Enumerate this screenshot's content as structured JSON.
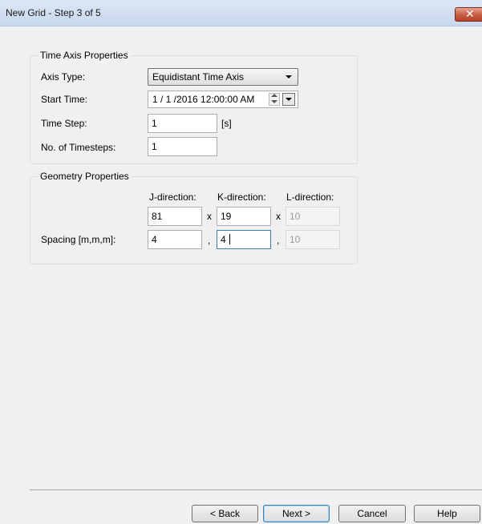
{
  "window": {
    "title": "New Grid - Step 3 of 5",
    "close_glyph": "✕"
  },
  "time_axis": {
    "legend": "Time Axis Properties",
    "axis_type_label": "Axis Type:",
    "axis_type_value": "Equidistant Time Axis",
    "start_time_label": "Start Time:",
    "start_time_value": "1 / 1 /2016 12:00:00 AM",
    "time_step_label": "Time Step:",
    "time_step_value": "1",
    "time_step_unit": "[s]",
    "timesteps_label": "No. of Timesteps:",
    "timesteps_value": "1"
  },
  "geometry": {
    "legend": "Geometry Properties",
    "j_header": "J-direction:",
    "k_header": "K-direction:",
    "l_header": "L-direction:",
    "j_count": "81",
    "k_count": "19",
    "l_count": "10",
    "times_sep_1": "x",
    "times_sep_2": "x",
    "spacing_label": "Spacing [m,m,m]:",
    "j_spacing": "4",
    "k_spacing": "4",
    "l_spacing": "10",
    "comma_sep_1": ",",
    "comma_sep_2": ","
  },
  "buttons": {
    "back": "< Back",
    "next": "Next >",
    "cancel": "Cancel",
    "help": "Help"
  }
}
